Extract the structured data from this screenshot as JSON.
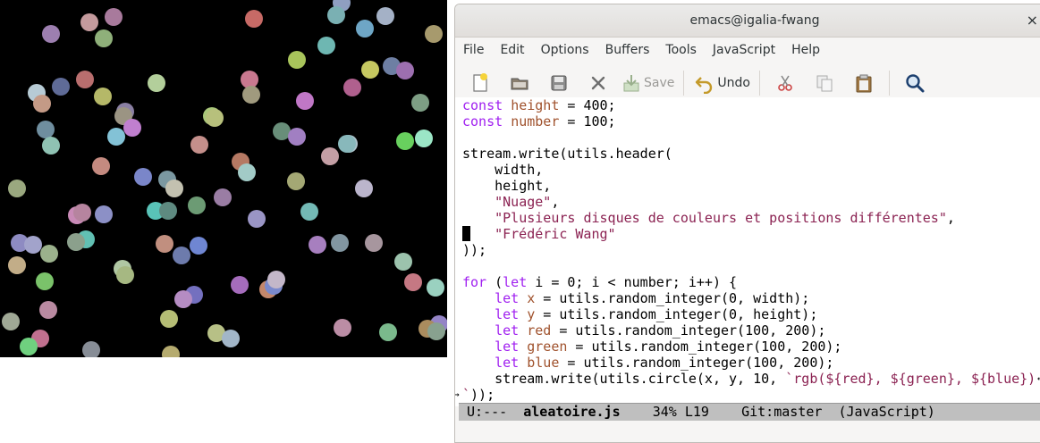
{
  "canvas": {
    "background": "#000000",
    "circle_radius": 10,
    "circles": [
      [
        57,
        38,
        "#9d7fb0"
      ],
      [
        100,
        25,
        "#c49a9d"
      ],
      [
        127,
        19,
        "#a87a9c"
      ],
      [
        116,
        43,
        "#8fb07a"
      ],
      [
        284,
        21,
        "#c76a66"
      ],
      [
        382,
        3,
        "#8f9fc1"
      ],
      [
        376,
        17,
        "#7ab0b3"
      ],
      [
        431,
        18,
        "#a4b1c6"
      ],
      [
        408,
        32,
        "#6ea6c6"
      ],
      [
        485,
        38,
        "#a79a6d"
      ],
      [
        365,
        51,
        "#6eb7b2"
      ],
      [
        332,
        67,
        "#a8c45b"
      ],
      [
        414,
        78,
        "#c6c861"
      ],
      [
        438,
        74,
        "#6e7fa3"
      ],
      [
        453,
        79,
        "#9d6fb0"
      ],
      [
        41,
        104,
        "#b7cbd5"
      ],
      [
        47,
        116,
        "#c49a86"
      ],
      [
        68,
        97,
        "#5f6b97"
      ],
      [
        95,
        89,
        "#b96e6e"
      ],
      [
        115,
        108,
        "#b5b868"
      ],
      [
        175,
        93,
        "#b3cf9b"
      ],
      [
        279,
        89,
        "#c9788f"
      ],
      [
        281,
        106,
        "#a09a7e"
      ],
      [
        394,
        98,
        "#b0608e"
      ],
      [
        470,
        115,
        "#7d9e84"
      ],
      [
        140,
        125,
        "#8a7fa3"
      ],
      [
        138,
        130,
        "#9b9483"
      ],
      [
        148,
        143,
        "#c07fcf"
      ],
      [
        130,
        153,
        "#83c2d6"
      ],
      [
        51,
        145,
        "#6f8e9f"
      ],
      [
        57,
        163,
        "#8fc2b3"
      ],
      [
        237,
        130,
        "#a9c77a"
      ],
      [
        240,
        132,
        "#b7c07c"
      ],
      [
        341,
        113,
        "#c077c6"
      ],
      [
        315,
        147,
        "#688e79"
      ],
      [
        332,
        153,
        "#a17fc2"
      ],
      [
        390,
        161,
        "#aec3cc"
      ],
      [
        388,
        161,
        "#88b8bb"
      ],
      [
        453,
        158,
        "#68d05e"
      ],
      [
        474,
        155,
        "#9be6c6"
      ],
      [
        223,
        162,
        "#c48f8b"
      ],
      [
        113,
        186,
        "#c48a80"
      ],
      [
        269,
        181,
        "#b57963"
      ],
      [
        276,
        193,
        "#a2cbc7"
      ],
      [
        369,
        175,
        "#c49fa5"
      ],
      [
        19,
        211,
        "#9aa87f"
      ],
      [
        160,
        198,
        "#7a86c9"
      ],
      [
        187,
        201,
        "#7b98a1"
      ],
      [
        195,
        211,
        "#c3c1b0"
      ],
      [
        331,
        203,
        "#a4a874"
      ],
      [
        407,
        211,
        "#bbb5cc"
      ],
      [
        86,
        241,
        "#c98ab7"
      ],
      [
        92,
        238,
        "#b6849f"
      ],
      [
        116,
        240,
        "#8c90c6"
      ],
      [
        174,
        236,
        "#59c3b8"
      ],
      [
        188,
        236,
        "#5e8a80"
      ],
      [
        220,
        230,
        "#6c9b74"
      ],
      [
        249,
        221,
        "#9a7da4"
      ],
      [
        287,
        245,
        "#9a95c5"
      ],
      [
        346,
        237,
        "#73b9b5"
      ],
      [
        22,
        272,
        "#8e8bc2"
      ],
      [
        37,
        274,
        "#a2a3cb"
      ],
      [
        96,
        268,
        "#61c0b3"
      ],
      [
        85,
        271,
        "#8ba08c"
      ],
      [
        55,
        284,
        "#9bb18c"
      ],
      [
        184,
        273,
        "#c18f7f"
      ],
      [
        222,
        275,
        "#6f86d2"
      ],
      [
        203,
        286,
        "#6d7bac"
      ],
      [
        355,
        274,
        "#a77fbf"
      ],
      [
        380,
        272,
        "#8296a1"
      ],
      [
        418,
        272,
        "#a7969e"
      ],
      [
        19,
        297,
        "#c2ad88"
      ],
      [
        50,
        315,
        "#7ac26a"
      ],
      [
        137,
        301,
        "#b0c7a3"
      ],
      [
        140,
        308,
        "#a6b882"
      ],
      [
        268,
        319,
        "#a56cbc"
      ],
      [
        300,
        324,
        "#c4876b"
      ],
      [
        306,
        320,
        "#7a89cc"
      ],
      [
        309,
        313,
        "#c3b7c9"
      ],
      [
        217,
        330,
        "#7470bf"
      ],
      [
        205,
        335,
        "#b58cc3"
      ],
      [
        451,
        293,
        "#9cc3ad"
      ],
      [
        462,
        316,
        "#c57883"
      ],
      [
        487,
        322,
        "#9ad1c0"
      ],
      [
        54,
        347,
        "#b98aa1"
      ],
      [
        12,
        360,
        "#9fa895"
      ],
      [
        189,
        357,
        "#b5bd75"
      ],
      [
        383,
        367,
        "#bb8da5"
      ],
      [
        434,
        372,
        "#7ab98c"
      ],
      [
        491,
        363,
        "#9484c6"
      ],
      [
        478,
        368,
        "#aa8c5e"
      ],
      [
        488,
        371,
        "#88a18f"
      ],
      [
        45,
        379,
        "#c1708f"
      ],
      [
        32,
        388,
        "#6fd07f"
      ],
      [
        242,
        373,
        "#b7c086"
      ],
      [
        258,
        379,
        "#a2b6c8"
      ],
      [
        102,
        392,
        "#878d96"
      ],
      [
        191,
        397,
        "#b5ab6f"
      ]
    ]
  },
  "window": {
    "title": "emacs@igalia-fwang",
    "close_glyph": "×"
  },
  "menu": [
    "File",
    "Edit",
    "Options",
    "Buffers",
    "Tools",
    "JavaScript",
    "Help"
  ],
  "toolbar": {
    "save_label": "Save",
    "undo_label": "Undo"
  },
  "editor": {
    "line1_kw": "const",
    "line1_var": "height",
    "line1_rest": " = 400;",
    "line2_kw": "const",
    "line2_var": "number",
    "line2_rest": " = 100;",
    "line4": "stream.write(utils.header(",
    "line5": "    width,",
    "line6": "    height,",
    "line7_str": "\"Nuage\"",
    "line7_rest": ",",
    "line8_str": "\"Plusieurs disques de couleurs et positions différentes\"",
    "line8_rest": ",",
    "line9_str": "\"Frédéric Wang\"",
    "line10": "));",
    "line12_kw": "for",
    "line12_a": " (",
    "line12_kw2": "let",
    "line12_rest": " i = 0; i < number; i++) {",
    "line13_kw": "let",
    "line13_var": "x",
    "line13_rest": " = utils.random_integer(0, width);",
    "line14_kw": "let",
    "line14_var": "y",
    "line14_rest": " = utils.random_integer(0, height);",
    "line15_kw": "let",
    "line15_var": "red",
    "line15_rest": " = utils.random_integer(100, 200);",
    "line16_kw": "let",
    "line16_var": "green",
    "line16_rest": " = utils.random_integer(100, 200);",
    "line17_kw": "let",
    "line17_var": "blue",
    "line17_rest": " = utils.random_integer(100, 200);",
    "line18_a": "    stream.write(utils.circle(x, y, 10, ",
    "line18_str": "`rgb(${red}, ${green}, ${blue})",
    "line19_str": "`",
    "line19_rest": "));"
  },
  "modeline": {
    "status": " U:---  ",
    "buffer": "aleatoire.js",
    "position": "    34% L19    ",
    "vc": "Git:master",
    "mode": "  (JavaScript)"
  }
}
